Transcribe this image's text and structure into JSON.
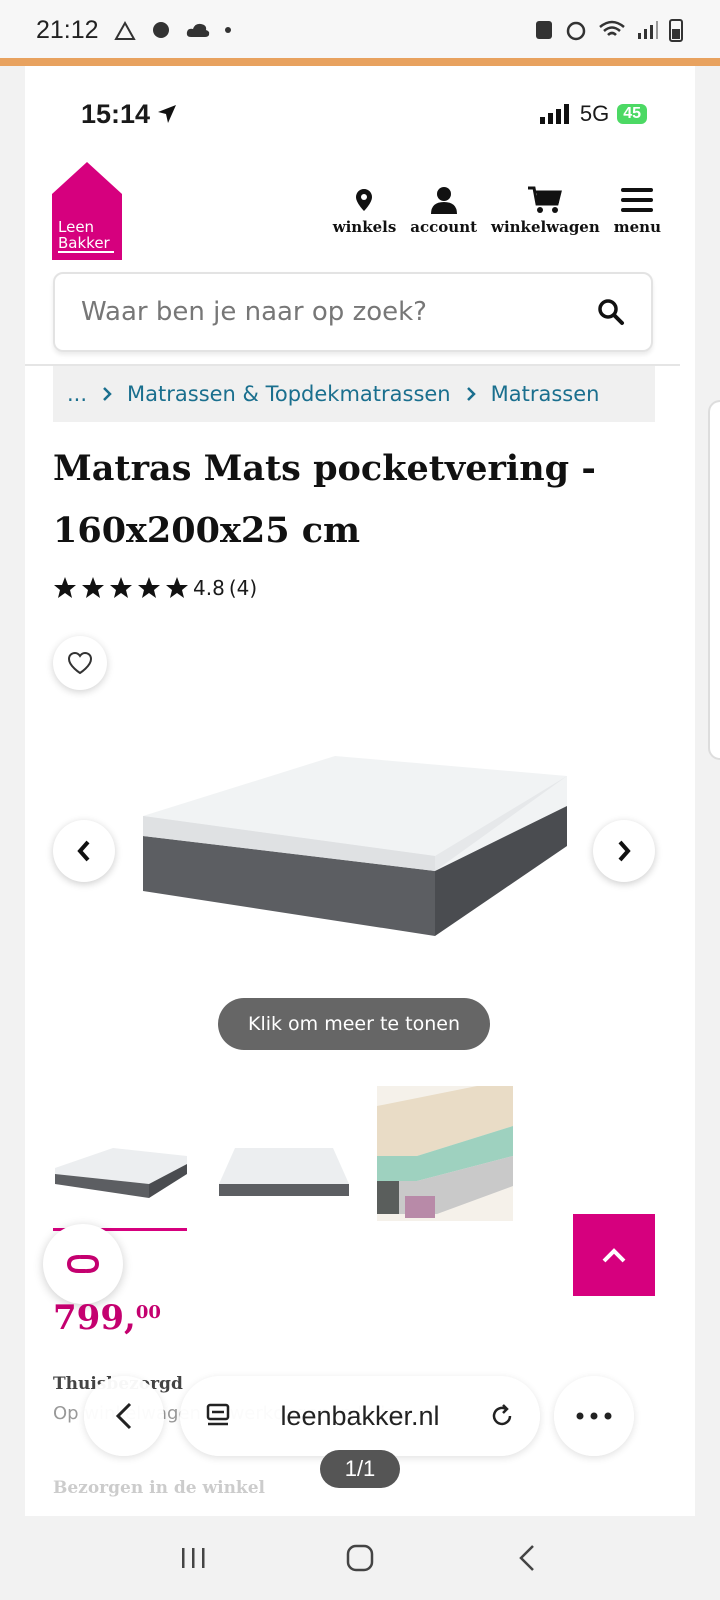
{
  "android_status": {
    "time": "21:12"
  },
  "ios_status": {
    "time": "15:14",
    "network": "5G",
    "battery": "45"
  },
  "header": {
    "logo_line1": "Leen",
    "logo_line2": "Bakker",
    "brand_color": "#d6007e",
    "nav": [
      {
        "label": "winkels",
        "icon": "map-pin-icon"
      },
      {
        "label": "account",
        "icon": "user-icon"
      },
      {
        "label": "winkelwagen",
        "icon": "cart-icon"
      },
      {
        "label": "menu",
        "icon": "hamburger-icon"
      }
    ]
  },
  "search": {
    "placeholder": "Waar ben je naar op zoek?"
  },
  "breadcrumb": {
    "ellipsis": "...",
    "items": [
      "Matrassen & Topdekmatrassen",
      "Matrassen"
    ]
  },
  "product": {
    "title": "Matras Mats pocketvering - 160x200x25 cm",
    "rating": "4.8",
    "review_count": "(4)",
    "stars": 5,
    "more_label": "Klik om meer te tonen",
    "price_main": "799,",
    "price_cents": "00"
  },
  "delivery": {
    "title": "Thuisbezorgd",
    "text": "Op winkelwagen ... werkdagen in huis",
    "store_title": "Bezorgen in de winkel"
  },
  "browser": {
    "url": "leenbakker.nl",
    "page_counter": "1/1"
  }
}
